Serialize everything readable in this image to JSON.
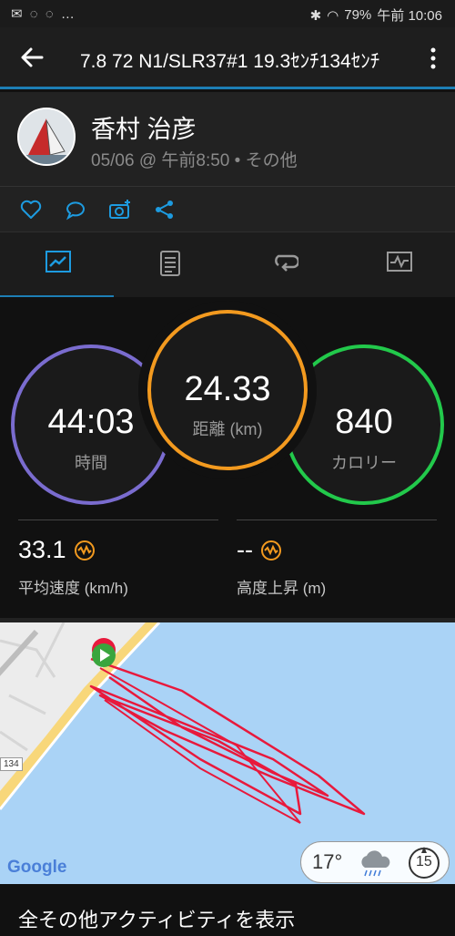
{
  "statusbar": {
    "left_icons": "✉ ◌ ◌ …",
    "battery": "79%",
    "time": "午前 10:06"
  },
  "appbar": {
    "title": "7.8 72 N1/SLR37#1 19.3ｾﾝﾁ134ｾﾝﾁ"
  },
  "profile": {
    "name": "香村 治彦",
    "meta": "05/06 @ 午前8:50 • その他"
  },
  "stats": {
    "time": {
      "value": "44:03",
      "label": "時間"
    },
    "distance": {
      "value": "24.33",
      "label": "距離 (km)"
    },
    "calories": {
      "value": "840",
      "label": "カロリー"
    },
    "avg_speed": {
      "value": "33.1",
      "label": "平均速度 (km/h)"
    },
    "elevation": {
      "value": "--",
      "label": "高度上昇 (m)"
    }
  },
  "map": {
    "road_badge": "134",
    "logo": "Google",
    "temp": "17°",
    "wind": "15"
  },
  "footer": {
    "label": "全その他アクティビティを表示"
  },
  "colors": {
    "accent": "#1d7fb5",
    "time_ring": "#7a6ccf",
    "distance_ring": "#f39a1f",
    "calorie_ring": "#22c94b",
    "track": "#e8193c"
  }
}
